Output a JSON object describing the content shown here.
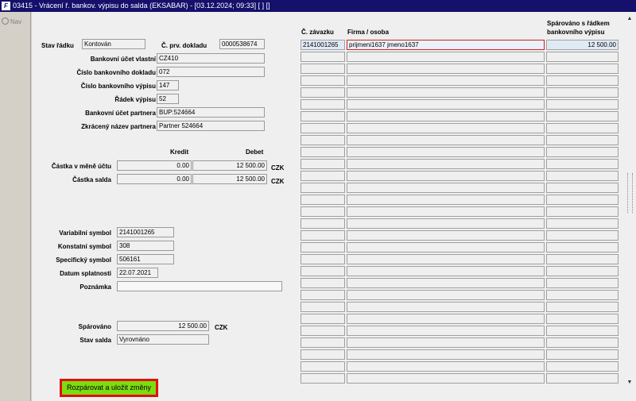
{
  "window": {
    "title": "03415 - Vrácení ř. bankov. výpisu do salda (EKSABAR) - [03.12.2024; 09:33] [ ] []"
  },
  "left_panel": {
    "nav_label": "Nav"
  },
  "form": {
    "stav_radku": {
      "label": "Stav řádku",
      "value": "Kontován"
    },
    "c_prv_dokladu": {
      "label": "Č. prv. dokladu",
      "value": "0000538674"
    },
    "bankovni_ucet_vlastni": {
      "label": "Bankovní účet vlastní",
      "value": "CZ410"
    },
    "cislo_bankovniho_dokladu": {
      "label": "Číslo bankovního dokladu",
      "value": "072"
    },
    "cislo_bankovniho_vypisu": {
      "label": "Číslo bankovního výpisu",
      "value": "147"
    },
    "radek_vypisu": {
      "label": "Řádek výpisu",
      "value": "52"
    },
    "bankovni_ucet_partnera": {
      "label": "Bankovní účet partnera",
      "value": "BUP:524664"
    },
    "zkraceny_nazev_partnera": {
      "label": "Zkrácený název partnera",
      "value": "Partner 524664"
    },
    "col_kredit": "Kredit",
    "col_debet": "Debet",
    "castka_v_mene_uctu": {
      "label": "Částka v měně účtu",
      "kredit": "0.00",
      "debet": "12 500.00",
      "currency": "CZK"
    },
    "castka_salda": {
      "label": "Částka salda",
      "kredit": "0.00",
      "debet": "12 500.00",
      "currency": "CZK"
    },
    "variabilni_symbol": {
      "label": "Variabilní symbol",
      "value": "2141001265"
    },
    "konstantni_symbol": {
      "label": "Konstatní symbol",
      "value": "308"
    },
    "specificky_symbol": {
      "label": "Specifický symbol",
      "value": "506161"
    },
    "datum_splatnosti": {
      "label": "Datum splatnosti",
      "value": "22.07.2021"
    },
    "poznamka": {
      "label": "Poznámka",
      "value": ""
    },
    "sparovano": {
      "label": "Spárováno",
      "value": "12 500.00",
      "currency": "CZK"
    },
    "stav_salda": {
      "label": "Stav salda",
      "value": "Vyrovnáno"
    }
  },
  "grid": {
    "headers": {
      "c_zavazku": "Č. závazku",
      "firma_osoba": "Firma / osoba",
      "sparovano_line1": "Spárováno s řádkem",
      "sparovano_line2": "bankovního výpisu"
    },
    "rows": [
      {
        "c_zavazku": "2141001265",
        "firma": "prijmeni1637 jmeno1637",
        "sparovano": "12 500.00"
      },
      {
        "c_zavazku": "",
        "firma": "",
        "sparovano": ""
      },
      {
        "c_zavazku": "",
        "firma": "",
        "sparovano": ""
      },
      {
        "c_zavazku": "",
        "firma": "",
        "sparovano": ""
      },
      {
        "c_zavazku": "",
        "firma": "",
        "sparovano": ""
      },
      {
        "c_zavazku": "",
        "firma": "",
        "sparovano": ""
      },
      {
        "c_zavazku": "",
        "firma": "",
        "sparovano": ""
      },
      {
        "c_zavazku": "",
        "firma": "",
        "sparovano": ""
      },
      {
        "c_zavazku": "",
        "firma": "",
        "sparovano": ""
      },
      {
        "c_zavazku": "",
        "firma": "",
        "sparovano": ""
      },
      {
        "c_zavazku": "",
        "firma": "",
        "sparovano": ""
      },
      {
        "c_zavazku": "",
        "firma": "",
        "sparovano": ""
      },
      {
        "c_zavazku": "",
        "firma": "",
        "sparovano": ""
      },
      {
        "c_zavazku": "",
        "firma": "",
        "sparovano": ""
      },
      {
        "c_zavazku": "",
        "firma": "",
        "sparovano": ""
      },
      {
        "c_zavazku": "",
        "firma": "",
        "sparovano": ""
      },
      {
        "c_zavazku": "",
        "firma": "",
        "sparovano": ""
      },
      {
        "c_zavazku": "",
        "firma": "",
        "sparovano": ""
      },
      {
        "c_zavazku": "",
        "firma": "",
        "sparovano": ""
      },
      {
        "c_zavazku": "",
        "firma": "",
        "sparovano": ""
      },
      {
        "c_zavazku": "",
        "firma": "",
        "sparovano": ""
      },
      {
        "c_zavazku": "",
        "firma": "",
        "sparovano": ""
      },
      {
        "c_zavazku": "",
        "firma": "",
        "sparovano": ""
      },
      {
        "c_zavazku": "",
        "firma": "",
        "sparovano": ""
      },
      {
        "c_zavazku": "",
        "firma": "",
        "sparovano": ""
      },
      {
        "c_zavazku": "",
        "firma": "",
        "sparovano": ""
      },
      {
        "c_zavazku": "",
        "firma": "",
        "sparovano": ""
      },
      {
        "c_zavazku": "",
        "firma": "",
        "sparovano": ""
      },
      {
        "c_zavazku": "",
        "firma": "",
        "sparovano": ""
      }
    ]
  },
  "scrollbar": {
    "up_icon": "▲",
    "down_icon": "▼"
  },
  "actions": {
    "rozparovat_label": "Rozpárovat a uložit změny",
    "button_color": "#7cdc10",
    "highlight_color": "#e01010"
  }
}
